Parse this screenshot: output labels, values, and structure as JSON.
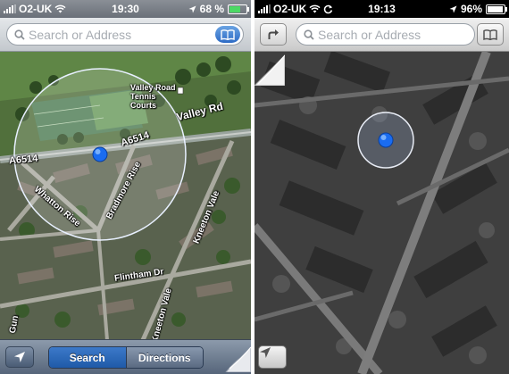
{
  "left_phone": {
    "status": {
      "carrier": "O2-UK",
      "time": "19:30",
      "battery": "68 %",
      "battery_level": 0.68
    },
    "search": {
      "placeholder": "Search or Address",
      "bookmark_icon": "book-icon"
    },
    "map_labels": {
      "valley_road_tennis_courts": "Valley Road Tennis Courts",
      "valley_rd": "Valley Rd",
      "a6514_east": "A6514",
      "a6514_west": "A6514",
      "whatton_rise": "Whatton Rise",
      "bradmore_rise": "Bradmore Rise",
      "kneeton_vale_north": "Kneeton Vale",
      "kneeton_vale_south": "Kneeton Vale",
      "flintham_dr": "Flintham Dr",
      "gun": "Gun"
    },
    "toolbar": {
      "search": "Search",
      "directions": "Directions",
      "selected": "Search"
    },
    "colors": {
      "location_dot": "#1a6cf0",
      "selected_segment": "#2a66b8"
    }
  },
  "right_phone": {
    "status": {
      "carrier": "O2-UK",
      "time": "19:13",
      "battery": "96%",
      "battery_level": 0.96
    },
    "search": {
      "placeholder": "Search or Address"
    },
    "colors": {
      "location_dot": "#1a6cf0"
    }
  }
}
